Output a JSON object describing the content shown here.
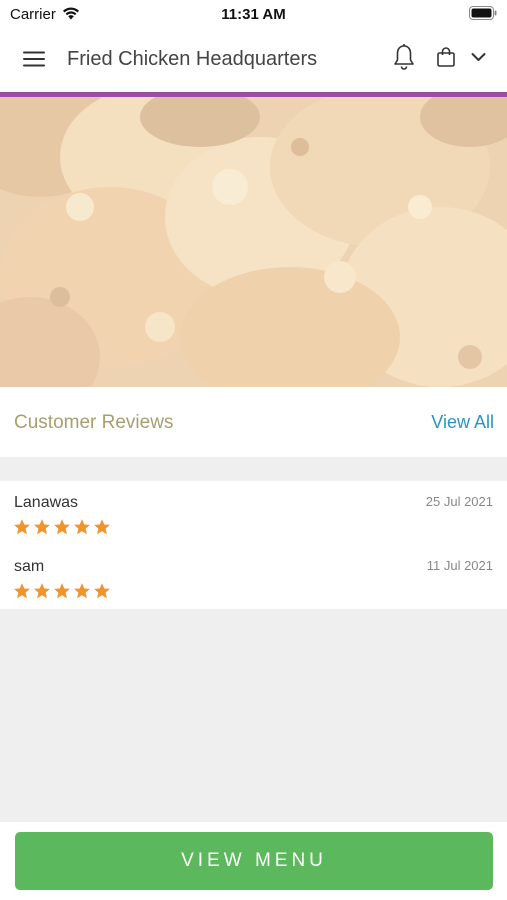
{
  "status_bar": {
    "carrier": "Carrier",
    "time": "11:31 AM"
  },
  "header": {
    "title": "Fried Chicken Headquarters",
    "accent_color": "#9c4ea6",
    "icons": [
      "menu-icon",
      "bell-icon",
      "bag-icon",
      "chevron-down-icon"
    ]
  },
  "hero": {
    "image": "fried-chicken-photo"
  },
  "reviews": {
    "title": "Customer Reviews",
    "view_all_label": "View All",
    "items": [
      {
        "name": "Lanawas",
        "date": "25 Jul 2021",
        "rating": 5
      },
      {
        "name": "sam",
        "date": "11 Jul 2021",
        "rating": 5
      }
    ]
  },
  "footer": {
    "button_label": "VIEW MENU",
    "button_color": "#5cb85c"
  }
}
